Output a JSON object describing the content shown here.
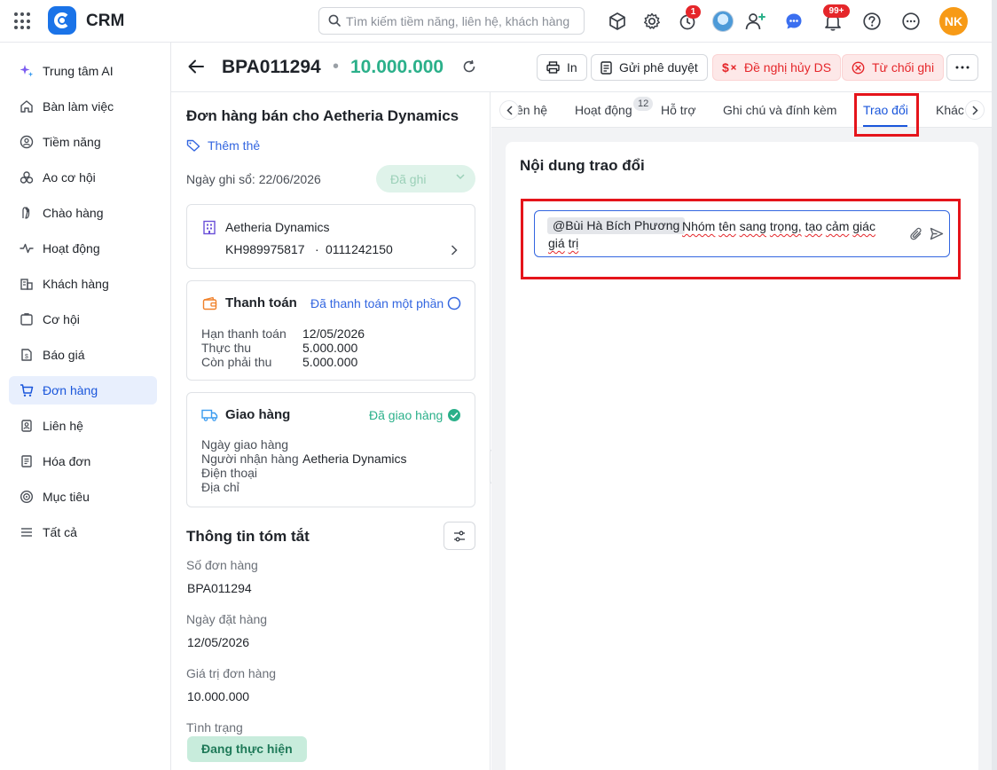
{
  "topbar": {
    "app_title": "CRM",
    "search_placeholder": "Tìm kiếm tiềm năng, liên hệ, khách hàng",
    "reminder_badge": "1",
    "notification_badge": "99+",
    "user_initials": "NK"
  },
  "sidebar": {
    "items": [
      {
        "label": "Trung tâm AI",
        "icon": "ai-sparkle-icon"
      },
      {
        "label": "Bàn làm việc",
        "icon": "home-icon"
      },
      {
        "label": "Tiềm năng",
        "icon": "lead-icon"
      },
      {
        "label": "Ao cơ hội",
        "icon": "opportunity-pool-icon"
      },
      {
        "label": "Chào hàng",
        "icon": "offer-icon"
      },
      {
        "label": "Hoạt động",
        "icon": "activity-icon"
      },
      {
        "label": "Khách hàng",
        "icon": "customer-icon"
      },
      {
        "label": "Cơ hội",
        "icon": "opportunity-icon"
      },
      {
        "label": "Báo giá",
        "icon": "quote-icon"
      },
      {
        "label": "Đơn hàng",
        "icon": "cart-icon"
      },
      {
        "label": "Liên hệ",
        "icon": "contact-icon"
      },
      {
        "label": "Hóa đơn",
        "icon": "invoice-icon"
      },
      {
        "label": "Mục tiêu",
        "icon": "target-icon"
      },
      {
        "label": "Tất cả",
        "icon": "menu-icon"
      }
    ],
    "active_item": "Đơn hàng"
  },
  "header": {
    "order_code": "BPA011294",
    "separator": "•",
    "order_amount": "10.000.000",
    "buttons": {
      "print": "In",
      "send_approval": "Gửi phê duyệt",
      "propose_cancel": "Đề nghị hủy DS",
      "reject": "Từ chối ghi"
    }
  },
  "order": {
    "title": "Đơn hàng bán cho Aetheria Dynamics",
    "add_tag": "Thêm thẻ",
    "record_date": "Ngày ghi sổ: 22/06/2026",
    "record_status": "Đã ghi",
    "customer": {
      "name": "Aetheria Dynamics",
      "code": "KH989975817",
      "dot": "·",
      "tax_code": "0111242150"
    },
    "payment": {
      "title": "Thanh toán",
      "status": "Đã thanh toán một phần",
      "rows": [
        {
          "label": "Hạn thanh toán",
          "value": "12/05/2026"
        },
        {
          "label": "Thực thu",
          "value": "5.000.000"
        },
        {
          "label": "Còn phải thu",
          "value": "5.000.000"
        }
      ]
    },
    "delivery": {
      "title": "Giao hàng",
      "status": "Đã giao hàng",
      "rows": [
        {
          "label": "Ngày giao hàng",
          "value": ""
        },
        {
          "label": "Người nhận hàng",
          "value": "Aetheria Dynamics"
        },
        {
          "label": "Điện thoại",
          "value": ""
        },
        {
          "label": "Địa chỉ",
          "value": ""
        }
      ]
    },
    "summary": {
      "title": "Thông tin tóm tắt",
      "fields": [
        {
          "label": "Số đơn hàng",
          "value": "BPA011294"
        },
        {
          "label": "Ngày đặt hàng",
          "value": "12/05/2026"
        },
        {
          "label": "Giá trị đơn hàng",
          "value": "10.000.000"
        },
        {
          "label": "Tình trạng",
          "value": "Đang thực hiện"
        }
      ]
    }
  },
  "tabs": {
    "items": [
      "ên hệ",
      "Hoạt động",
      "Hỗ trợ",
      "Ghi chú và đính kèm",
      "Trao đổi",
      "Khác"
    ],
    "activity_count": "12",
    "active": "Trao đổi"
  },
  "discussion": {
    "title": "Nội dung trao đổi",
    "mention": "@Bùi Hà Bích Phương",
    "message_words": [
      "Nhóm",
      "tên",
      "sang",
      "trọng,",
      "tạo",
      "cảm",
      "giác",
      "giá",
      "trị"
    ]
  },
  "colors": {
    "accent": "#1a56db",
    "amount_green": "#2bb08a",
    "danger": "#e5262a",
    "highlight": "#e5141b"
  }
}
